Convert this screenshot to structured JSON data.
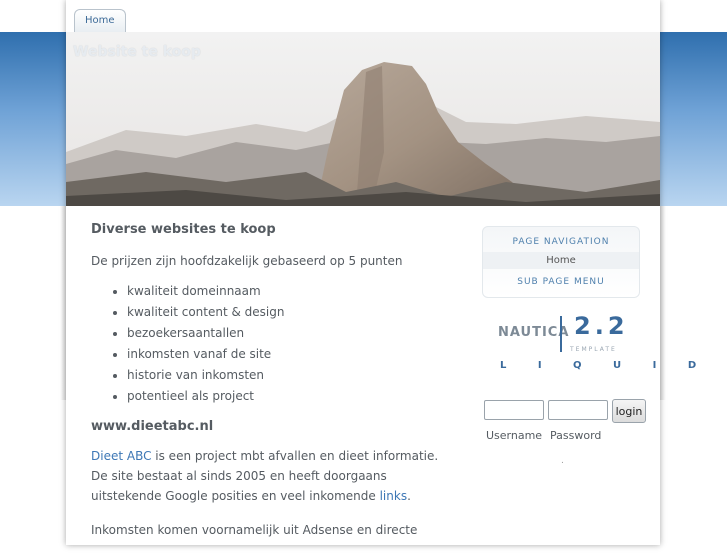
{
  "nav": {
    "home_tab": "Home"
  },
  "header": {
    "site_title": "Website te koop"
  },
  "main": {
    "heading": "Diverse websites te koop",
    "intro": "De prijzen zijn hoofdzakelijk gebaseerd op 5 punten",
    "points": [
      "kwaliteit domeinnaam",
      "kwaliteit content & design",
      "bezoekersaantallen",
      "inkomsten vanaf de site",
      "historie van inkomsten",
      "potentieel als project"
    ],
    "section_title": "www.dieetabc.nl",
    "para1_link": "Dieet ABC",
    "para1_text": " is een project mbt afvallen en dieet informatie. De site bestaat al sinds 2005 en heeft doorgaans uitstekende Google posities en veel inkomende ",
    "para1_link2": "links",
    "para1_end": ".",
    "para2": "Inkomsten komen voornamelijk uit Adsense en directe"
  },
  "sidebar": {
    "page_nav_title": "PAGE NAVIGATION",
    "page_nav_items": [
      "Home"
    ],
    "sub_menu_title": "SUB PAGE MENU",
    "logo": {
      "name": "NAUTICA",
      "version": "2.2",
      "template": "TEMPLATE",
      "liquid": "L I Q U I D"
    }
  },
  "login": {
    "button": "login",
    "username_label": "Username",
    "password_label": "Password"
  },
  "misc": {
    "dot": "."
  },
  "colors": {
    "link": "#3d77b5",
    "accent": "#4f80ad",
    "band_top": "#2f6fae",
    "band_bottom": "#b9d5f0"
  }
}
